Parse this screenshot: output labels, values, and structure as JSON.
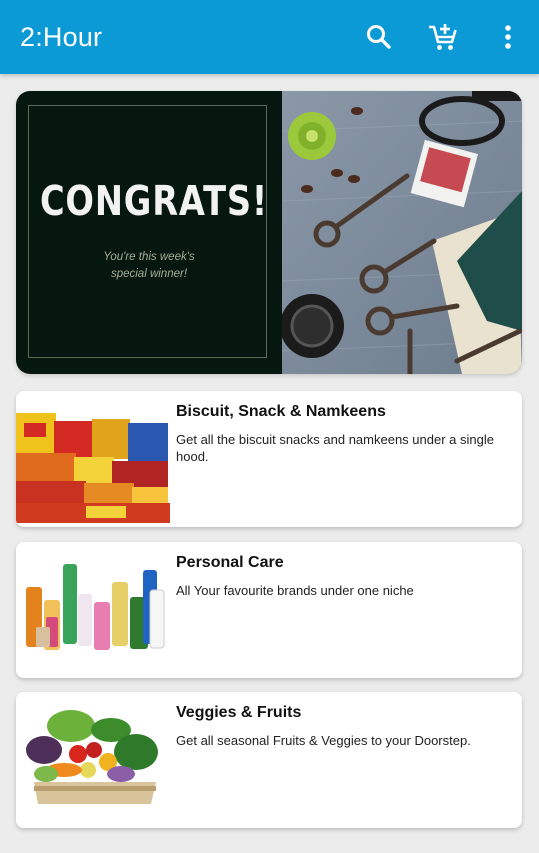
{
  "app_bar": {
    "title": "2:Hour",
    "background": "#0b9ad6",
    "actions": [
      {
        "icon": "search-icon"
      },
      {
        "icon": "add-to-cart-icon"
      },
      {
        "icon": "more-vert-icon"
      }
    ]
  },
  "banner": {
    "heading": "CONGRATS!",
    "subtext_line1": "You're this week's",
    "subtext_line2": "special winner!"
  },
  "categories": [
    {
      "title": "Biscuit, Snack & Namkeens",
      "description": "Get all the biscuit snacks and namkeens under a single hood.",
      "image": "snacks-image"
    },
    {
      "title": "Personal Care",
      "description": "All Your favourite brands under one niche",
      "image": "personal-care-image"
    },
    {
      "title": "Veggies & Fruits",
      "description": "Get all seasonal Fruits & Veggies  to your Doorstep.",
      "image": "veggies-fruits-image"
    }
  ]
}
